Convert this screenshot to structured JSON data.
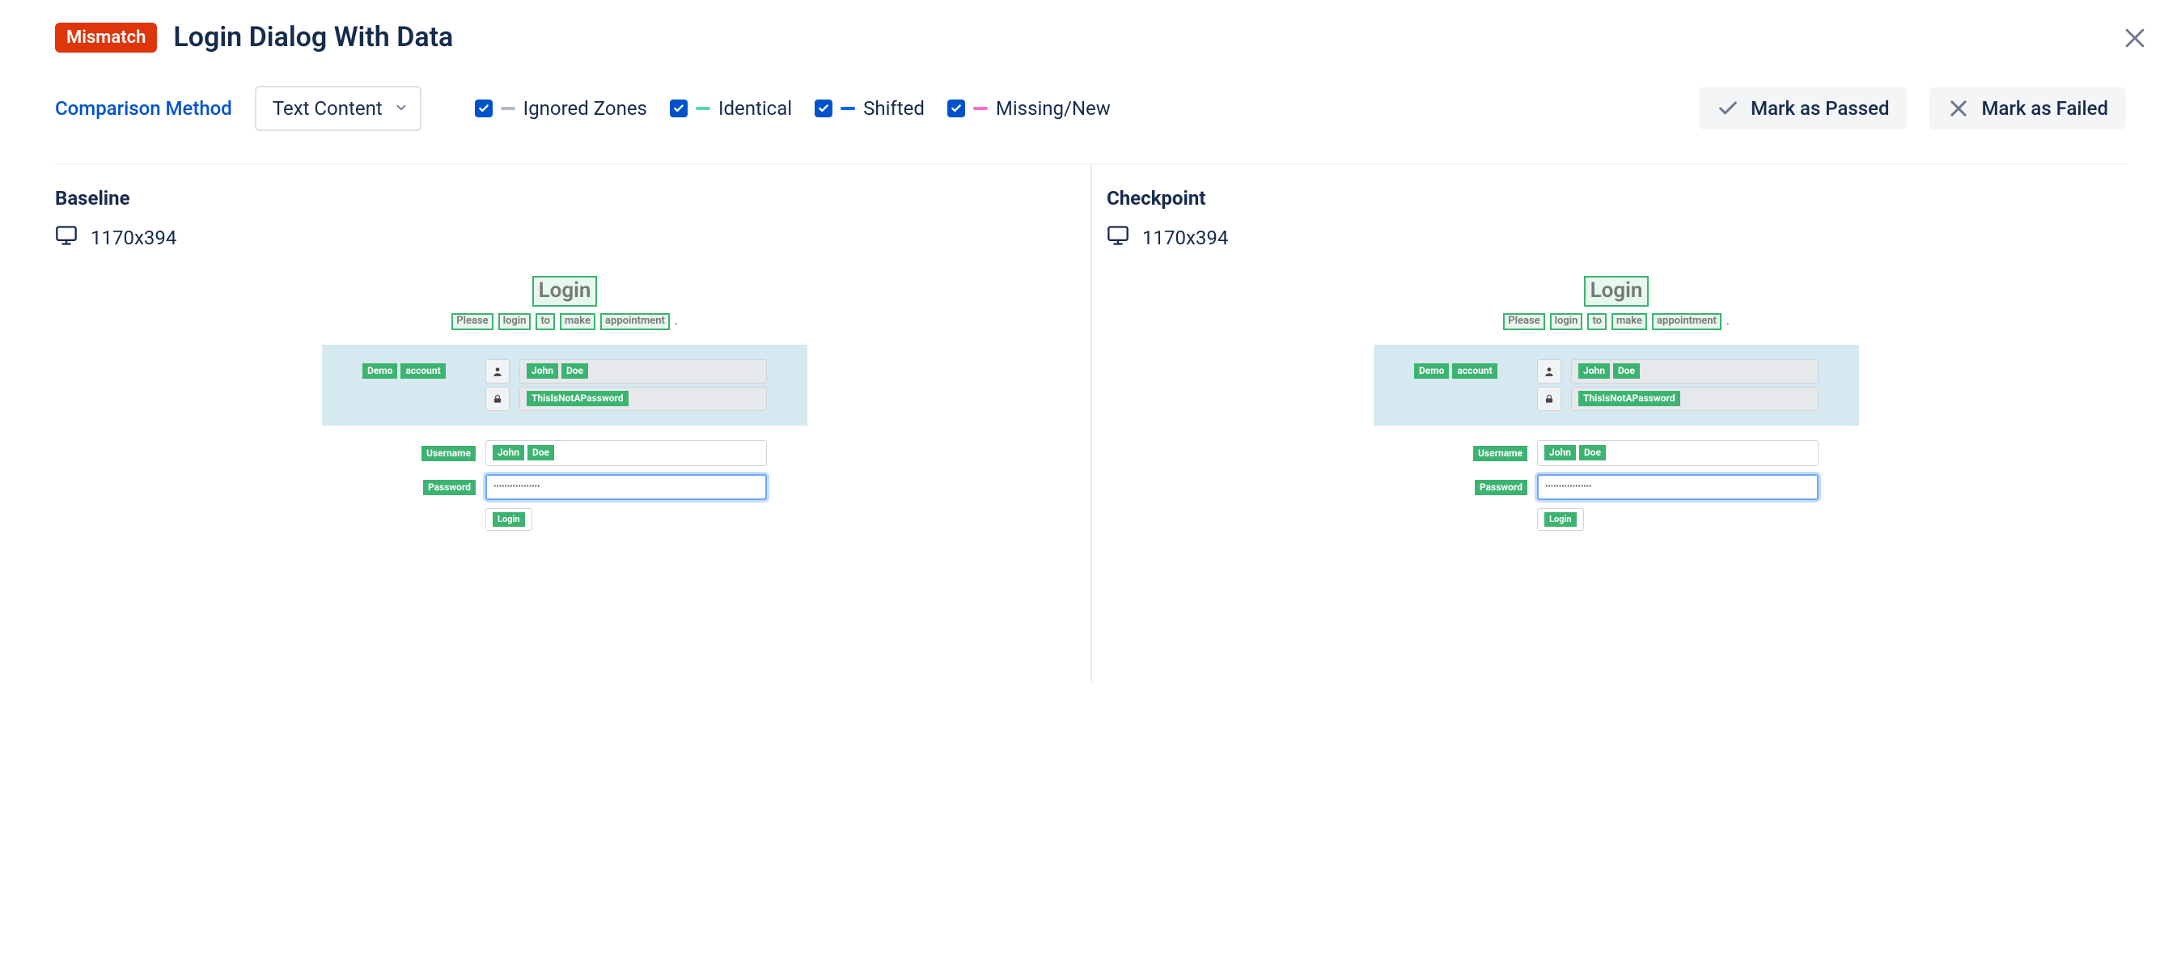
{
  "header": {
    "badge": "Mismatch",
    "title": "Login Dialog With Data"
  },
  "toolbar": {
    "comparison_label": "Comparison Method",
    "comparison_value": "Text Content",
    "legend": {
      "ignored": "Ignored Zones",
      "identical": "Identical",
      "shifted": "Shifted",
      "missing": "Missing/New"
    },
    "mark_passed": "Mark as Passed",
    "mark_failed": "Mark as Failed"
  },
  "panes": {
    "baseline": {
      "title": "Baseline",
      "resolution": "1170x394"
    },
    "checkpoint": {
      "title": "Checkpoint",
      "resolution": "1170x394"
    }
  },
  "mock": {
    "title": "Login",
    "sub_w1": "Please",
    "sub_w2": "login",
    "sub_w3": "to",
    "sub_w4": "make",
    "sub_w5": "appointment",
    "demo_label_w1": "Demo",
    "demo_label_w2": "account",
    "demo_user_w1": "John",
    "demo_user_w2": "Doe",
    "demo_pass": "ThisIsNotAPassword",
    "username_label": "Username",
    "username_w1": "John",
    "username_w2": "Doe",
    "password_label": "Password",
    "password_value": "•••••••••••••••••",
    "login_btn": "Login"
  },
  "colors": {
    "ignored": "#b3bac5",
    "identical": "#57d9a3",
    "shifted": "#0065ff",
    "missing": "#f76ecb"
  }
}
